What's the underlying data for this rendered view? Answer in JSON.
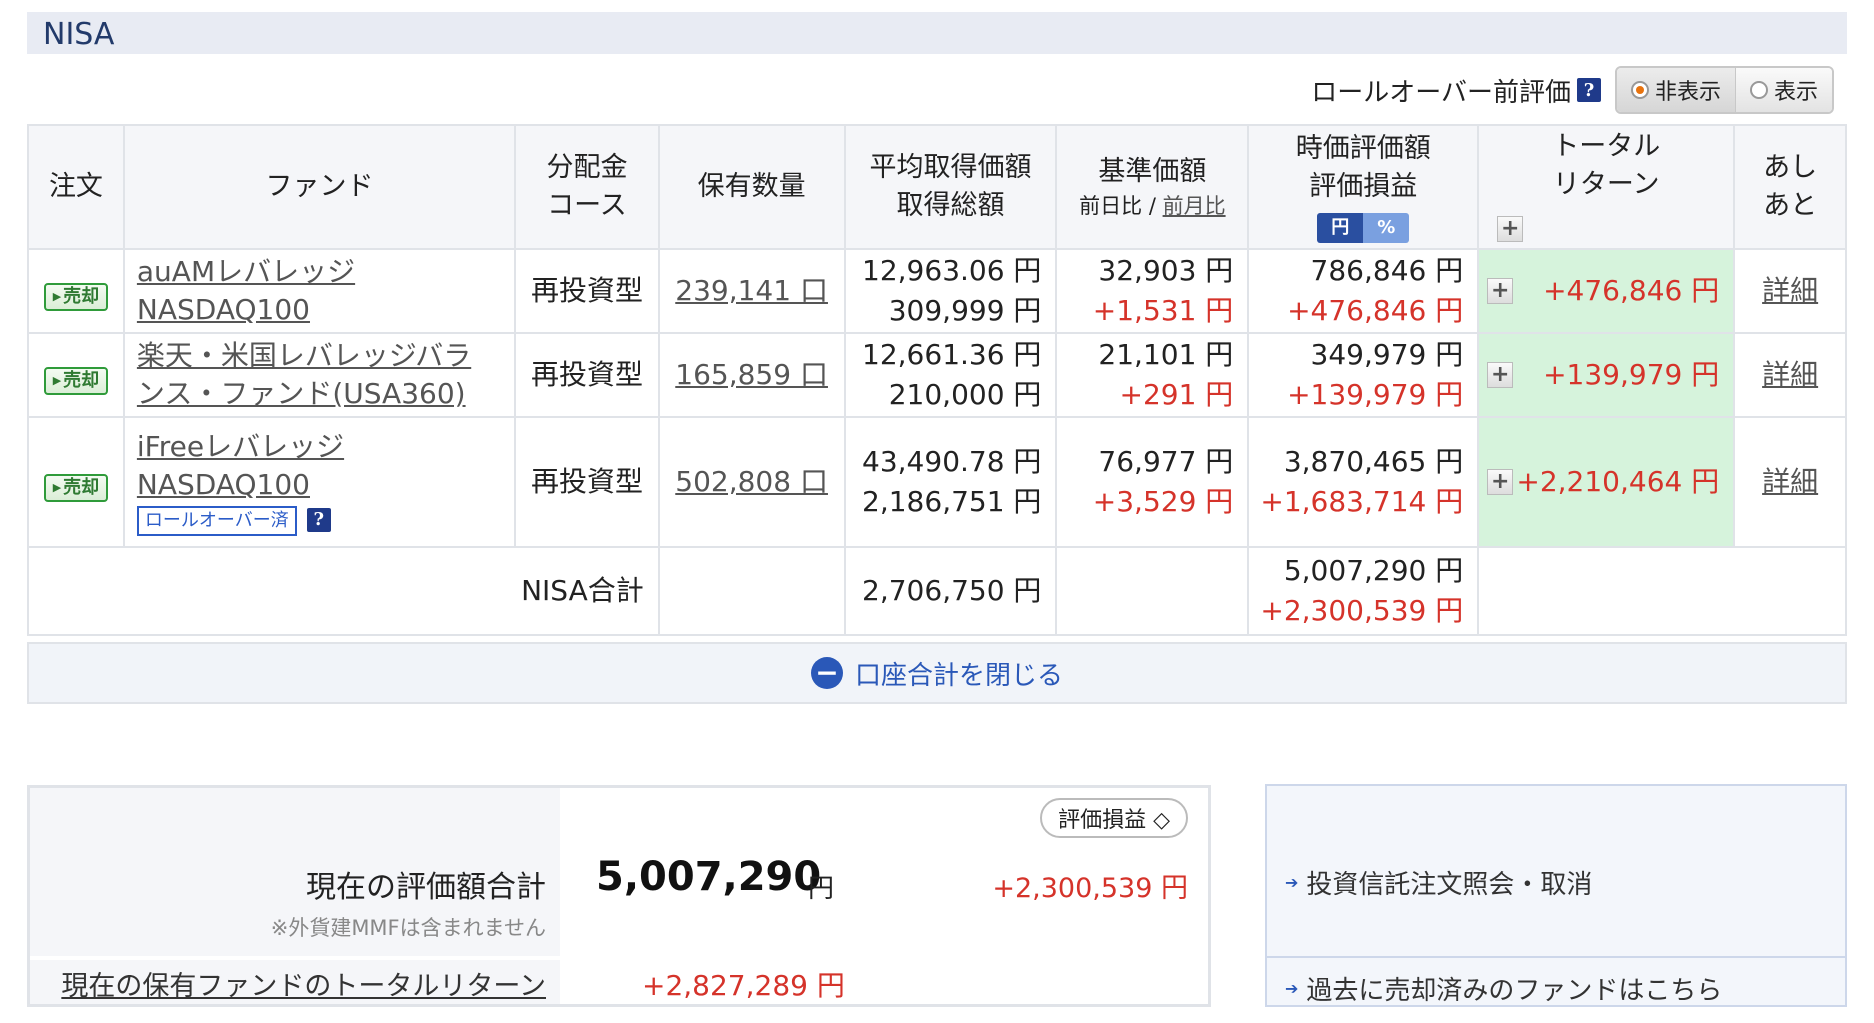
{
  "section": {
    "title": "NISA"
  },
  "rollover": {
    "label": "ロールオーバー前評価",
    "help": "?",
    "options": [
      {
        "label": "非表示",
        "selected": true
      },
      {
        "label": "表示",
        "selected": false
      }
    ]
  },
  "table": {
    "headers": {
      "order": "注文",
      "fund": "ファンド",
      "dist_1": "分配金",
      "dist_2": "コース",
      "qty": "保有数量",
      "avg_1": "平均取得価額",
      "avg_2": "取得総額",
      "base_1": "基準価額",
      "base_sub_day": "前日比",
      "base_sub_sep": "/",
      "base_sub_month": "前月比",
      "mv_1": "時価評価額",
      "mv_2": "評価損益",
      "unit_yen": "円",
      "unit_pct": "%",
      "tr_1": "トータル",
      "tr_2": "リターン",
      "hist_1": "あし",
      "hist_2": "あと"
    },
    "sell_label": "売却",
    "rows": [
      {
        "fund_1": "auAMレバレッジ",
        "fund_2": "NASDAQ100",
        "course": "再投資型",
        "qty": "239,141 口",
        "avg": "12,963.06 円",
        "total_cost": "309,999 円",
        "base": "32,903 円",
        "base_change": "+1,531 円",
        "mv": "786,846 円",
        "pl": "+476,846 円",
        "tr": "+476,846 円",
        "detail": "詳細",
        "badge": ""
      },
      {
        "fund_1": "楽天・米国レバレッジバラ",
        "fund_2": "ンス・ファンド(USA360)",
        "course": "再投資型",
        "qty": "165,859 口",
        "avg": "12,661.36 円",
        "total_cost": "210,000 円",
        "base": "21,101 円",
        "base_change": "+291 円",
        "mv": "349,979 円",
        "pl": "+139,979 円",
        "tr": "+139,979 円",
        "detail": "詳細",
        "badge": ""
      },
      {
        "fund_1": "iFreeレバレッジ",
        "fund_2": "NASDAQ100",
        "course": "再投資型",
        "qty": "502,808 口",
        "avg": "43,490.78 円",
        "total_cost": "2,186,751 円",
        "base": "76,977 円",
        "base_change": "+3,529 円",
        "mv": "3,870,465 円",
        "pl": "+1,683,714 円",
        "tr": "+2,210,464 円",
        "detail": "詳細",
        "badge": "ロールオーバー済"
      }
    ],
    "total": {
      "label": "NISA合計",
      "cost": "2,706,750 円",
      "mv": "5,007,290 円",
      "pl": "+2,300,539 円"
    }
  },
  "close_bar": {
    "label": "口座合計を閉じる"
  },
  "summary": {
    "label": "現在の評価額合計",
    "note": "※外貨建MMFは含まれません",
    "value": "5,007,290",
    "yen": "円",
    "select": "評価損益 ◇",
    "gain": "+2,300,539 円",
    "tr_label": "現在の保有ファンドのトータルリターン",
    "tr_value": "+2,827,289 円"
  },
  "links": [
    "投資信託注文照会・取消",
    "過去に売却済みのファンドはこちら"
  ],
  "colors": {
    "positive": "#d5332a",
    "header_bg": "#e8ebf3",
    "tr_bg": "#d6f3dc",
    "accent": "#2a58b8"
  }
}
